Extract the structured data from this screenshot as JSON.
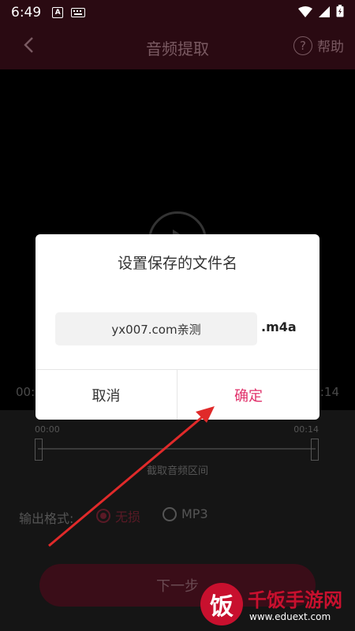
{
  "status": {
    "time": "6:49"
  },
  "header": {
    "title": "音频提取",
    "help": "帮助"
  },
  "video": {
    "time_start": "00:",
    "time_end": ":14"
  },
  "timeline": {
    "start": "00:00",
    "end": "00:14",
    "label": "截取音频区间"
  },
  "format": {
    "label": "输出格式:",
    "options": [
      "无损",
      "MP3"
    ],
    "selected": "无损"
  },
  "next_button": "下一步",
  "dialog": {
    "title": "设置保存的文件名",
    "filename": "yx007.com亲测",
    "extension": ".m4a",
    "cancel": "取消",
    "confirm": "确定"
  },
  "watermark": {
    "name": "千饭手游网",
    "url": "www.eduext.com",
    "logo_char": "饭"
  },
  "colors": {
    "accent": "#e0306a",
    "header_bg": "#2a0a12",
    "watermark": "#c8102e"
  }
}
